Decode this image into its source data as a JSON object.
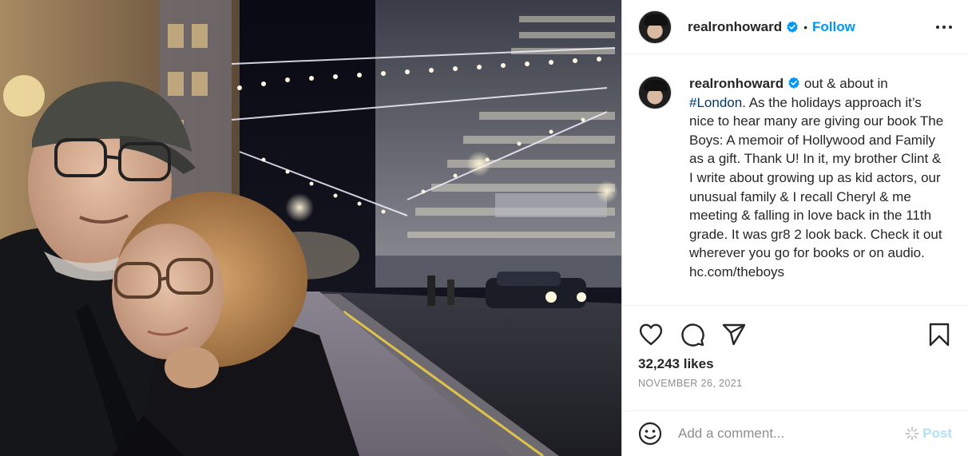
{
  "post": {
    "username": "realronhoward",
    "follow_label": "Follow",
    "separator": "•",
    "caption_text": "out & about in ",
    "caption_hashtag": "#London",
    "caption_rest": ". As the holidays approach it’s nice to hear many are giving our book The Boys: A memoir of Hollywood and Family as a gift. Thank U! In it, my brother Clint & I write about growing up as kid actors, our unusual family & I recall Cheryl & me meeting & falling in love back in the 11th grade. It was gr8 2 look back. Check it out wherever you go for books or on audio. hc.com/theboys",
    "likes": "32,243 likes",
    "date": "November 26, 2021"
  },
  "comment": {
    "placeholder": "Add a comment...",
    "post_label": "Post"
  },
  "icons": {
    "verified": "verified-badge-icon",
    "more": "more-options-icon",
    "like": "heart-icon",
    "comment": "comment-icon",
    "share": "share-icon",
    "save": "bookmark-icon",
    "emoji": "emoji-icon"
  },
  "colors": {
    "accent": "#0095f6",
    "hashtag": "#00376b",
    "muted": "#8e8e8e",
    "post_disabled": "#b2dffc"
  }
}
